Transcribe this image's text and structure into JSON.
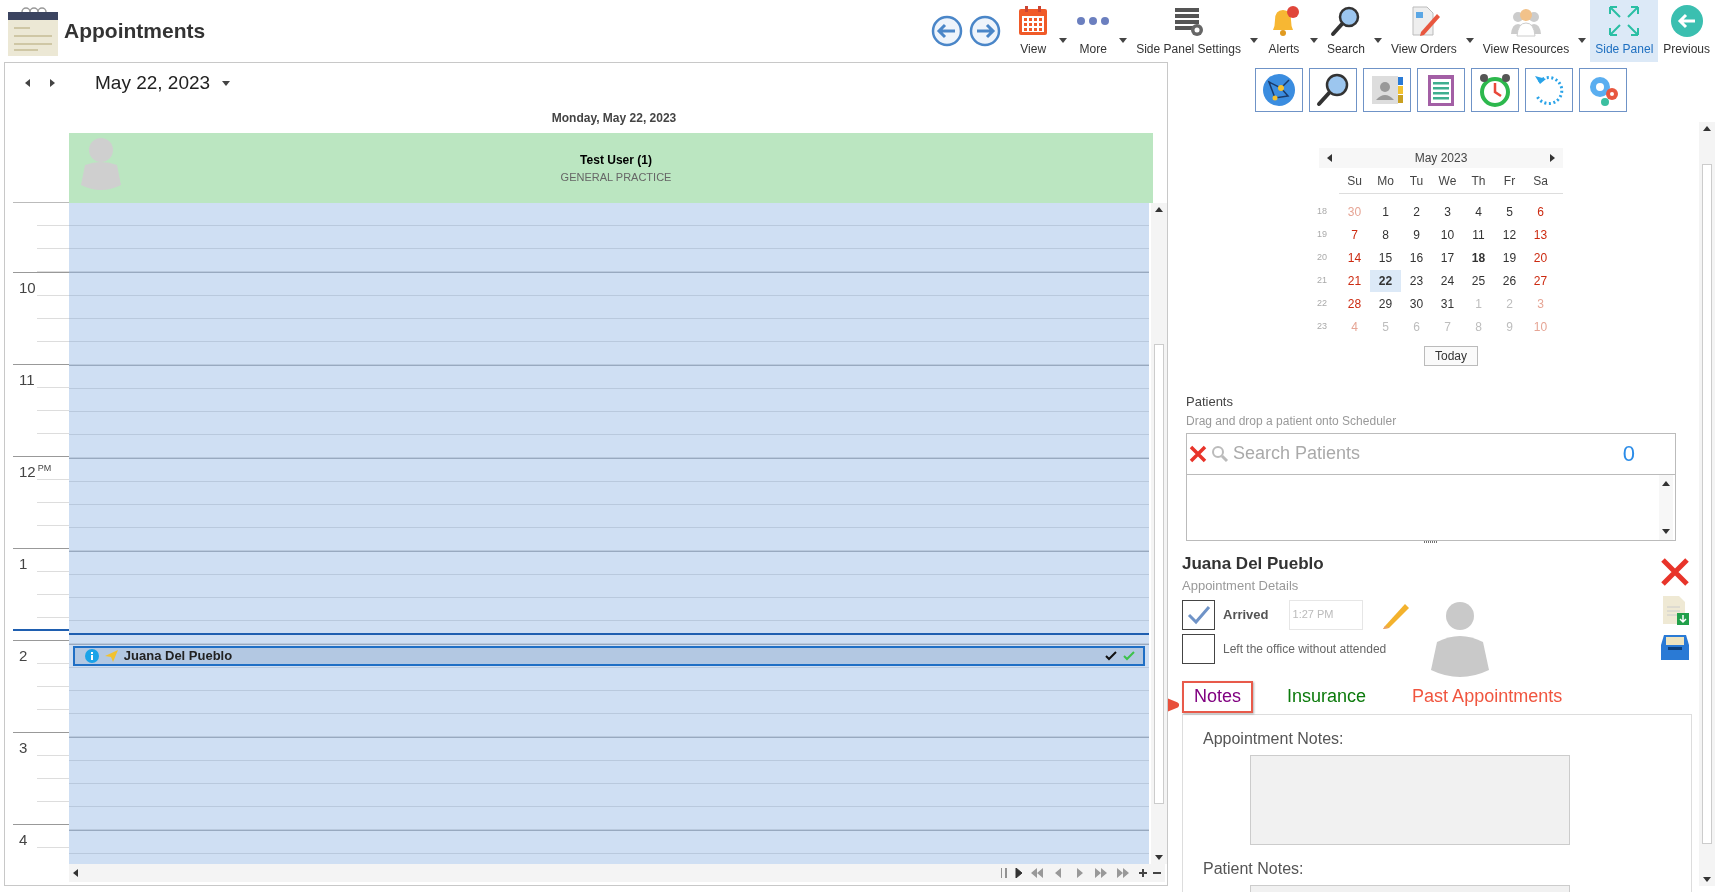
{
  "window": {
    "title": "Appointments"
  },
  "toolbar": [
    {
      "label": "View",
      "dropdown": true,
      "selected": false
    },
    {
      "label": "More",
      "dropdown": true,
      "selected": false
    },
    {
      "label": "Side Panel Settings",
      "dropdown": true,
      "selected": false
    },
    {
      "label": "Alerts",
      "dropdown": true,
      "selected": false
    },
    {
      "label": "Search",
      "dropdown": true,
      "selected": false
    },
    {
      "label": "View Orders",
      "dropdown": true,
      "selected": false
    },
    {
      "label": "View Resources",
      "dropdown": true,
      "selected": false
    },
    {
      "label": "Side Panel",
      "dropdown": false,
      "selected": true
    },
    {
      "label": "Previous",
      "dropdown": false,
      "selected": false
    }
  ],
  "scheduler": {
    "date": "May 22, 2023",
    "day_header": "Monday, May 22, 2023",
    "resource": {
      "name": "Test User (1)",
      "specialty": "GENERAL PRACTICE"
    },
    "hours": [
      {
        "label": "10",
        "now": false
      },
      {
        "label": "11",
        "now": false
      },
      {
        "label": "12",
        "suffix": "PM",
        "now": false
      },
      {
        "label": "1",
        "now": false
      },
      {
        "label": "2",
        "now": true,
        "appointments": [
          {
            "title": "Juana Del Pueblo",
            "arrived": true,
            "confirmed": true
          }
        ]
      },
      {
        "label": "3",
        "now": false
      },
      {
        "label": "4",
        "now": false
      }
    ]
  },
  "mini_calendar": {
    "title": "May 2023",
    "weekdays": [
      "Su",
      "Mo",
      "Tu",
      "We",
      "Th",
      "Fr",
      "Sa"
    ],
    "weeks": [
      {
        "week": "18",
        "days": [
          {
            "label": "30",
            "outside": true,
            "today": false,
            "selected": false
          },
          {
            "label": "1",
            "outside": false,
            "today": false,
            "selected": false
          },
          {
            "label": "2",
            "outside": false,
            "today": false,
            "selected": false
          },
          {
            "label": "3",
            "outside": false,
            "today": false,
            "selected": false
          },
          {
            "label": "4",
            "outside": false,
            "today": false,
            "selected": false
          },
          {
            "label": "5",
            "outside": false,
            "today": false,
            "selected": false
          },
          {
            "label": "6",
            "outside": false,
            "today": false,
            "selected": false
          }
        ]
      },
      {
        "week": "19",
        "days": [
          {
            "label": "7",
            "outside": false,
            "today": false,
            "selected": false
          },
          {
            "label": "8",
            "outside": false,
            "today": false,
            "selected": false
          },
          {
            "label": "9",
            "outside": false,
            "today": false,
            "selected": false
          },
          {
            "label": "10",
            "outside": false,
            "today": false,
            "selected": false
          },
          {
            "label": "11",
            "outside": false,
            "today": false,
            "selected": false
          },
          {
            "label": "12",
            "outside": false,
            "today": false,
            "selected": false
          },
          {
            "label": "13",
            "outside": false,
            "today": false,
            "selected": false
          }
        ]
      },
      {
        "week": "20",
        "days": [
          {
            "label": "14",
            "outside": false,
            "today": false,
            "selected": false
          },
          {
            "label": "15",
            "outside": false,
            "today": false,
            "selected": false
          },
          {
            "label": "16",
            "outside": false,
            "today": false,
            "selected": false
          },
          {
            "label": "17",
            "outside": false,
            "today": false,
            "selected": false
          },
          {
            "label": "18",
            "outside": false,
            "today": true,
            "selected": false
          },
          {
            "label": "19",
            "outside": false,
            "today": false,
            "selected": false
          },
          {
            "label": "20",
            "outside": false,
            "today": false,
            "selected": false
          }
        ]
      },
      {
        "week": "21",
        "days": [
          {
            "label": "21",
            "outside": false,
            "today": false,
            "selected": false
          },
          {
            "label": "22",
            "outside": false,
            "today": false,
            "selected": true
          },
          {
            "label": "23",
            "outside": false,
            "today": false,
            "selected": false
          },
          {
            "label": "24",
            "outside": false,
            "today": false,
            "selected": false
          },
          {
            "label": "25",
            "outside": false,
            "today": false,
            "selected": false
          },
          {
            "label": "26",
            "outside": false,
            "today": false,
            "selected": false
          },
          {
            "label": "27",
            "outside": false,
            "today": false,
            "selected": false
          }
        ]
      },
      {
        "week": "22",
        "days": [
          {
            "label": "28",
            "outside": false,
            "today": false,
            "selected": false
          },
          {
            "label": "29",
            "outside": false,
            "today": false,
            "selected": false
          },
          {
            "label": "30",
            "outside": false,
            "today": false,
            "selected": false
          },
          {
            "label": "31",
            "outside": false,
            "today": false,
            "selected": false
          },
          {
            "label": "1",
            "outside": true,
            "today": false,
            "selected": false
          },
          {
            "label": "2",
            "outside": true,
            "today": false,
            "selected": false
          },
          {
            "label": "3",
            "outside": true,
            "today": false,
            "selected": false
          }
        ]
      },
      {
        "week": "23",
        "days": [
          {
            "label": "4",
            "outside": true,
            "today": false,
            "selected": false
          },
          {
            "label": "5",
            "outside": true,
            "today": false,
            "selected": false
          },
          {
            "label": "6",
            "outside": true,
            "today": false,
            "selected": false
          },
          {
            "label": "7",
            "outside": true,
            "today": false,
            "selected": false
          },
          {
            "label": "8",
            "outside": true,
            "today": false,
            "selected": false
          },
          {
            "label": "9",
            "outside": true,
            "today": false,
            "selected": false
          },
          {
            "label": "10",
            "outside": true,
            "today": false,
            "selected": false
          }
        ]
      }
    ],
    "today_button": "Today"
  },
  "patients": {
    "title": "Patients",
    "hint": "Drag and drop a patient onto Scheduler",
    "search": {
      "placeholder": "Search Patients"
    },
    "count": "0"
  },
  "appointment": {
    "patient": "Juana Del Pueblo",
    "subtitle": "Appointment Details",
    "checks": [
      {
        "label": "Arrived",
        "checked": true,
        "time": "1:27 PM"
      },
      {
        "label": "Left the office without attended",
        "checked": false
      }
    ],
    "tabs": [
      {
        "label": "Notes",
        "color": "#800080",
        "highlighted": true
      },
      {
        "label": "Insurance",
        "color": "#0b7a0b",
        "highlighted": false
      },
      {
        "label": "Past Appointments",
        "color": "#f0553f",
        "highlighted": false
      }
    ],
    "notes": [
      {
        "label": "Appointment Notes:"
      },
      {
        "label": "Patient Notes:"
      }
    ]
  }
}
